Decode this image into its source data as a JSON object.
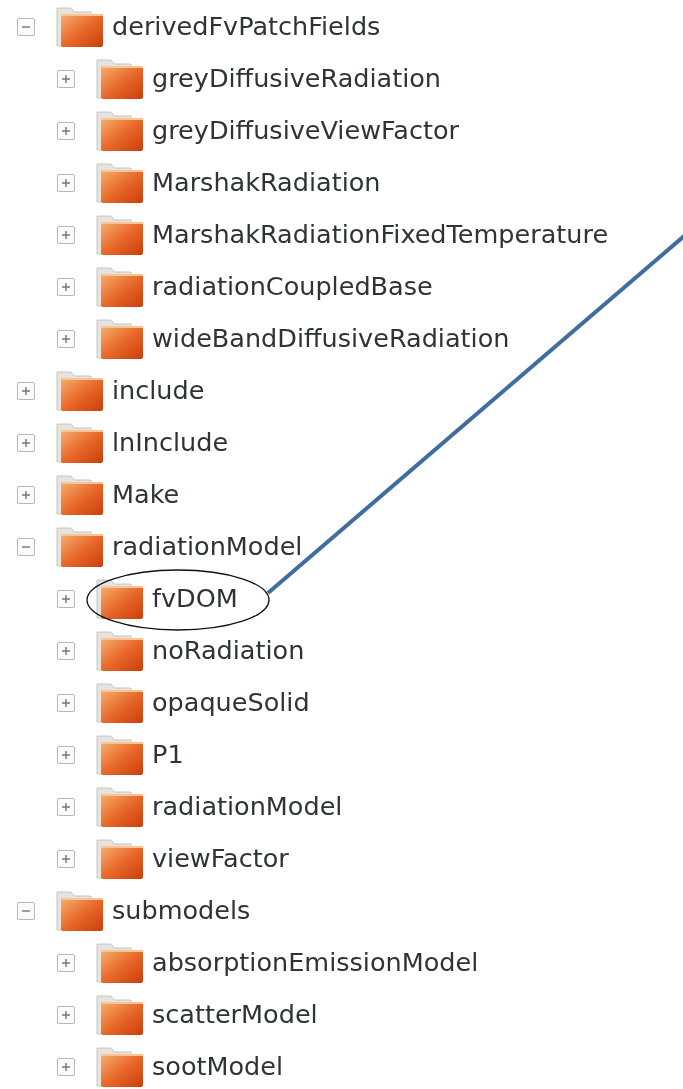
{
  "tree": [
    {
      "label": "derivedFvPatchFields",
      "expanded": true,
      "children": [
        {
          "label": "greyDiffusiveRadiation",
          "expanded": false
        },
        {
          "label": "greyDiffusiveViewFactor",
          "expanded": false
        },
        {
          "label": "MarshakRadiation",
          "expanded": false
        },
        {
          "label": "MarshakRadiationFixedTemperature",
          "expanded": false
        },
        {
          "label": "radiationCoupledBase",
          "expanded": false
        },
        {
          "label": "wideBandDiffusiveRadiation",
          "expanded": false
        }
      ]
    },
    {
      "label": "include",
      "expanded": false
    },
    {
      "label": "lnInclude",
      "expanded": false
    },
    {
      "label": "Make",
      "expanded": false
    },
    {
      "label": "radiationModel",
      "expanded": true,
      "children": [
        {
          "label": "fvDOM",
          "expanded": false,
          "circled": true
        },
        {
          "label": "noRadiation",
          "expanded": false
        },
        {
          "label": "opaqueSolid",
          "expanded": false
        },
        {
          "label": "P1",
          "expanded": false
        },
        {
          "label": "radiationModel",
          "expanded": false
        },
        {
          "label": "viewFactor",
          "expanded": false
        }
      ]
    },
    {
      "label": "submodels",
      "expanded": true,
      "children": [
        {
          "label": "absorptionEmissionModel",
          "expanded": false
        },
        {
          "label": "scatterModel",
          "expanded": false
        },
        {
          "label": "sootModel",
          "expanded": false
        }
      ]
    }
  ]
}
